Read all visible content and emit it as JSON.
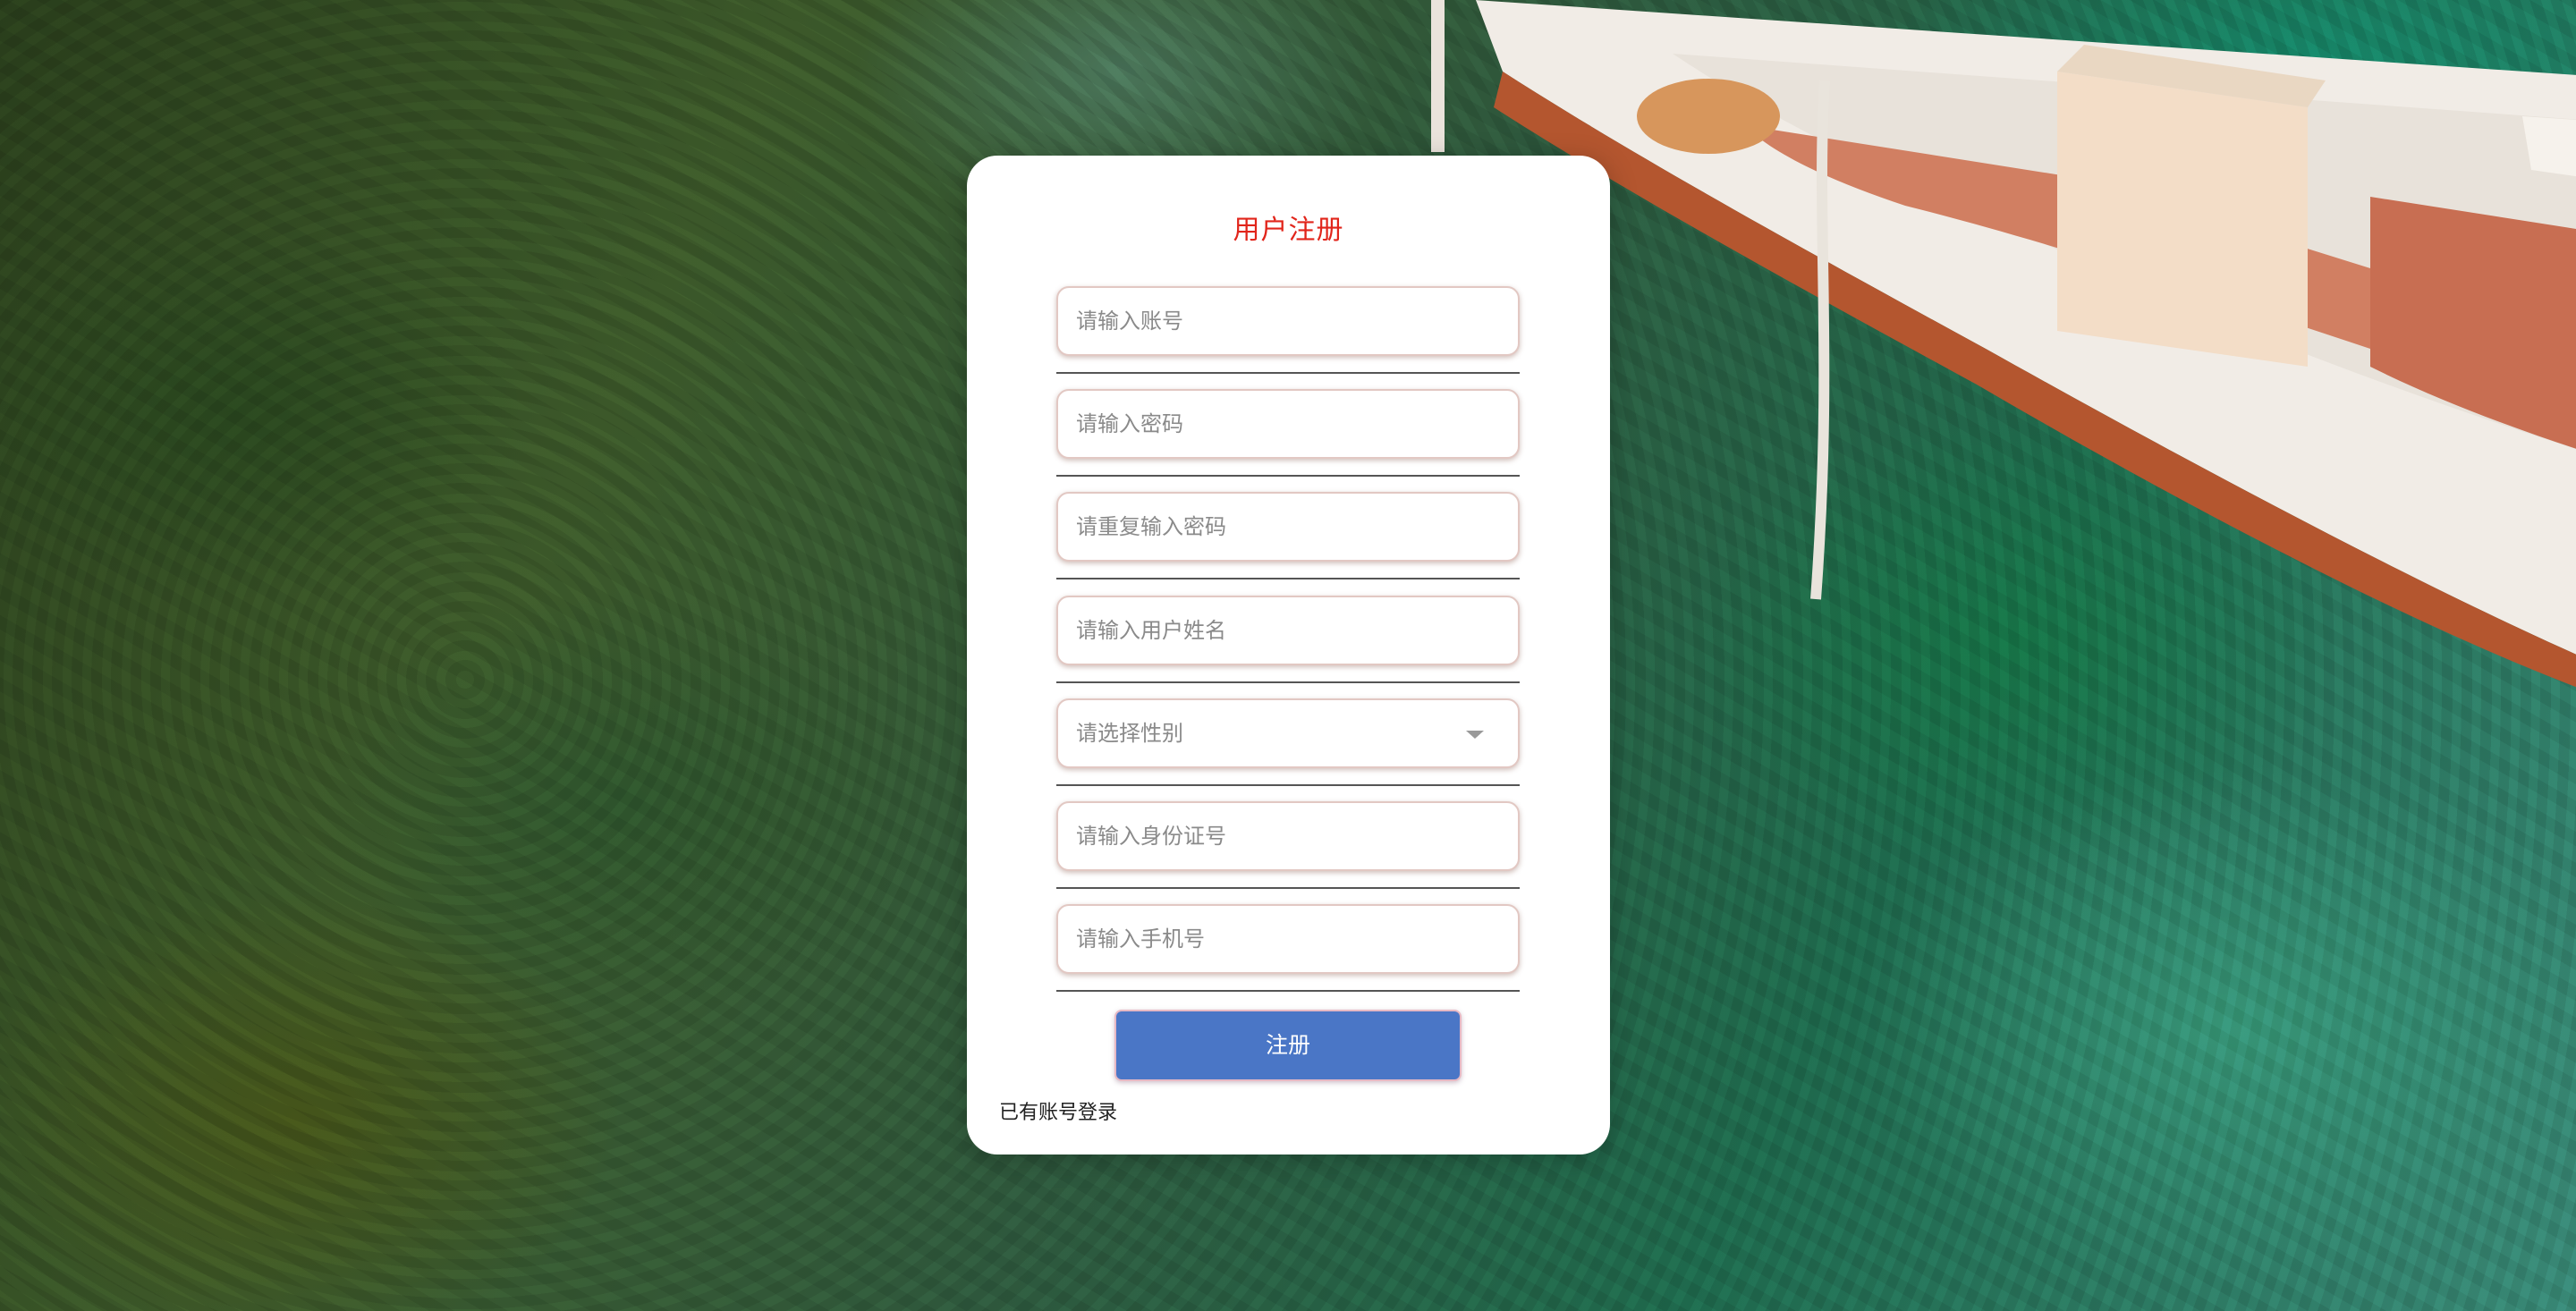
{
  "form": {
    "title": "用户注册",
    "fields": [
      {
        "name": "account",
        "placeholder": "请输入账号",
        "type": "text"
      },
      {
        "name": "password",
        "placeholder": "请输入密码",
        "type": "password"
      },
      {
        "name": "password-repeat",
        "placeholder": "请重复输入密码",
        "type": "password"
      },
      {
        "name": "username",
        "placeholder": "请输入用户姓名",
        "type": "text"
      },
      {
        "name": "gender",
        "placeholder": "请选择性别",
        "type": "select"
      },
      {
        "name": "id-number",
        "placeholder": "请输入身份证号",
        "type": "text"
      },
      {
        "name": "phone",
        "placeholder": "请输入手机号",
        "type": "text"
      }
    ],
    "submit_label": "注册",
    "login_link": "已有账号登录"
  },
  "colors": {
    "title": "#e1251b",
    "button": "#4a76c6",
    "card": "#ffffff"
  },
  "icons": {
    "gender_select": "caret-down-icon"
  },
  "background": "photo of clear sea water with a moored wooden boat"
}
